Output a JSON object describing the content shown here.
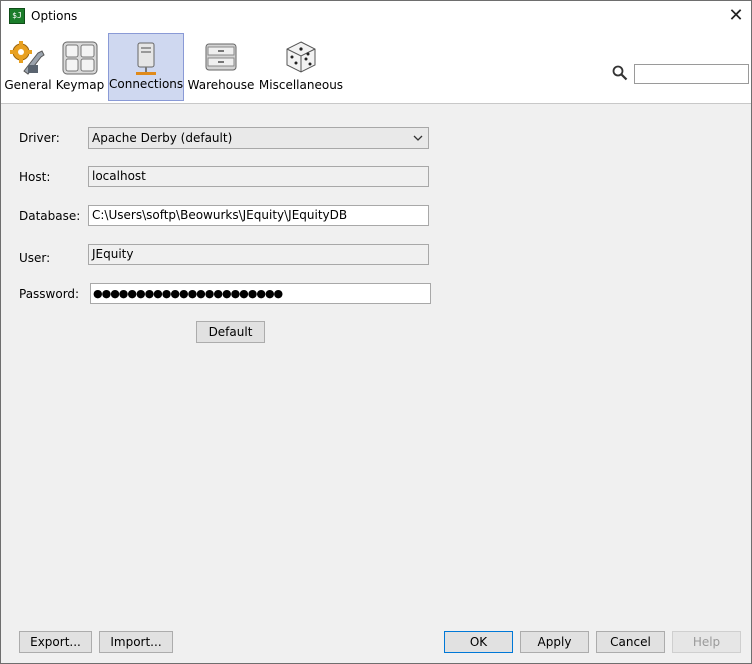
{
  "window": {
    "title": "Options",
    "app_icon_text": "$J",
    "close_glyph": "✕"
  },
  "toolbar": {
    "tabs": [
      {
        "label": "General",
        "icon": "gear-wrench-icon"
      },
      {
        "label": "Keymap",
        "icon": "keyboard-icon"
      },
      {
        "label": "Connections",
        "icon": "network-server-icon",
        "selected": true
      },
      {
        "label": "Warehouse",
        "icon": "storage-drawers-icon"
      },
      {
        "label": "Miscellaneous",
        "icon": "dice-icon"
      }
    ],
    "search": {
      "value": "",
      "placeholder": "",
      "icon": "search-icon"
    }
  },
  "form": {
    "driver": {
      "label": "Driver:",
      "value": "Apache Derby (default)"
    },
    "host": {
      "label": "Host:",
      "value": "localhost"
    },
    "database": {
      "label": "Database:",
      "value": "C:\\Users\\softp\\Beowurks\\JEquity\\JEquityDB"
    },
    "user": {
      "label": "User:",
      "value": "JEquity"
    },
    "password": {
      "label": "Password:",
      "value": "●●●●●●●●●●●●●●●●●●●●●●"
    },
    "default_button": "Default"
  },
  "footer": {
    "export": "Export...",
    "import": "Import...",
    "ok": "OK",
    "apply": "Apply",
    "cancel": "Cancel",
    "help": "Help"
  },
  "colors": {
    "selected_tab_bg": "#cfd8f0",
    "selected_tab_border": "#8a9ad6",
    "primary_button_border": "#0078d7"
  }
}
